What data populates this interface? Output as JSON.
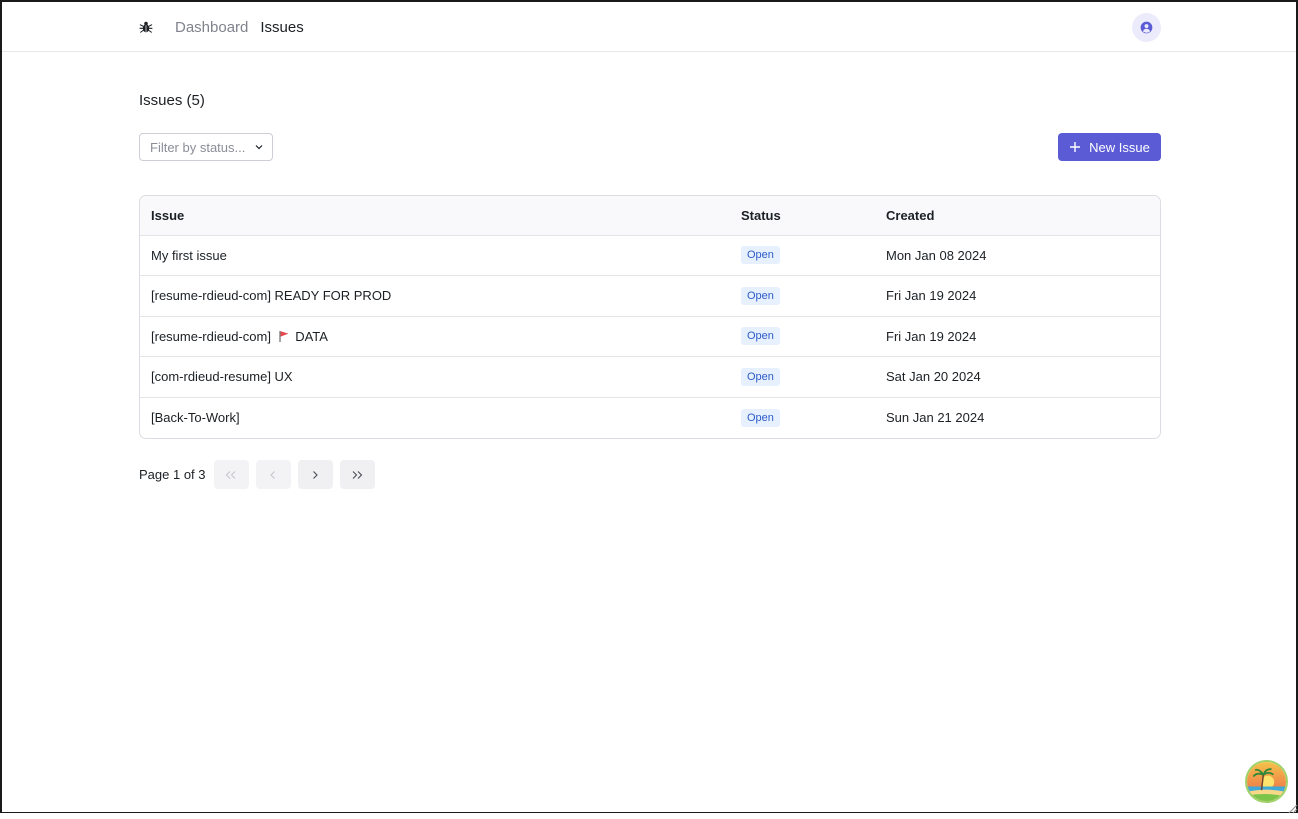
{
  "nav": {
    "logo_icon": "bug-icon",
    "links": [
      {
        "label": "Dashboard"
      },
      {
        "label": "Issues"
      }
    ],
    "avatar_icon": "user-circle-icon"
  },
  "page": {
    "title": "Issues (5)"
  },
  "filter": {
    "placeholder": "Filter by status...",
    "icon": "chevron-down-icon"
  },
  "new_button": {
    "label": "New Issue",
    "icon": "plus-icon"
  },
  "table": {
    "headers": {
      "issue": "Issue",
      "status": "Status",
      "created": "Created"
    },
    "rows": [
      {
        "issue": "My first issue",
        "status": "Open",
        "created": "Mon Jan 08 2024"
      },
      {
        "issue": "[resume-rdieud-com] READY FOR PROD",
        "status": "Open",
        "created": "Fri Jan 19 2024"
      },
      {
        "issue_prefix": "[resume-rdieud-com]",
        "issue_suffix": "DATA",
        "status": "Open",
        "created": "Fri Jan 19 2024"
      },
      {
        "issue": "[com-rdieud-resume] UX",
        "status": "Open",
        "created": "Sat Jan 20 2024"
      },
      {
        "issue": "[Back-To-Work]",
        "status": "Open",
        "created": "Sun Jan 21 2024"
      }
    ]
  },
  "pagination": {
    "label": "Page 1 of 3"
  },
  "colors": {
    "accent": "#5b5bd6",
    "badge_bg": "#e6f0fe",
    "badge_text": "#2d5bc9",
    "flag": "#e5484d"
  }
}
